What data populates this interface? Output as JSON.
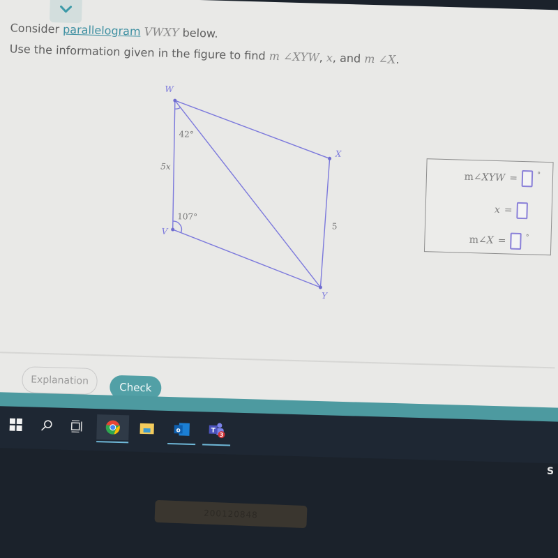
{
  "header": {
    "collapse_icon": "chevron-down-icon"
  },
  "question": {
    "line1_prefix": "Consider ",
    "line1_link": "parallelogram",
    "line1_shape": "VWXY",
    "line1_suffix": " below.",
    "line2_prefix": "Use the information given in the figure to find ",
    "line2_math1": "m ∠XYW",
    "line2_sep1": ", ",
    "line2_math2": "x",
    "line2_sep2": ", and ",
    "line2_math3": "m ∠X",
    "line2_end": "."
  },
  "figure": {
    "vertices": {
      "W": "W",
      "X": "X",
      "Y": "Y",
      "V": "V"
    },
    "angle_W": "42°",
    "angle_V": "107°",
    "side_VW": "5x",
    "side_XY": "5",
    "line_color": "#7b78dc"
  },
  "answers": [
    {
      "label_m": "m",
      "label": "∠XYW",
      "equals": "=",
      "value": "",
      "unit": "°"
    },
    {
      "label_m": "",
      "label": "x",
      "equals": "=",
      "value": "",
      "unit": ""
    },
    {
      "label_m": "m",
      "label": "∠X",
      "equals": "=",
      "value": "",
      "unit": "°"
    }
  ],
  "footer": {
    "explanation_label": "Explanation",
    "check_label": "Check",
    "accent_color": "#52a0a6"
  },
  "taskbar": {
    "items": [
      {
        "icon": "windows-start-icon"
      },
      {
        "icon": "search-icon"
      },
      {
        "icon": "task-view-icon"
      },
      {
        "icon": "chrome-icon",
        "active": true
      },
      {
        "icon": "file-explorer-icon"
      },
      {
        "icon": "outlook-icon"
      },
      {
        "icon": "teams-icon",
        "badge": "3"
      }
    ]
  },
  "device_label": "200120848"
}
